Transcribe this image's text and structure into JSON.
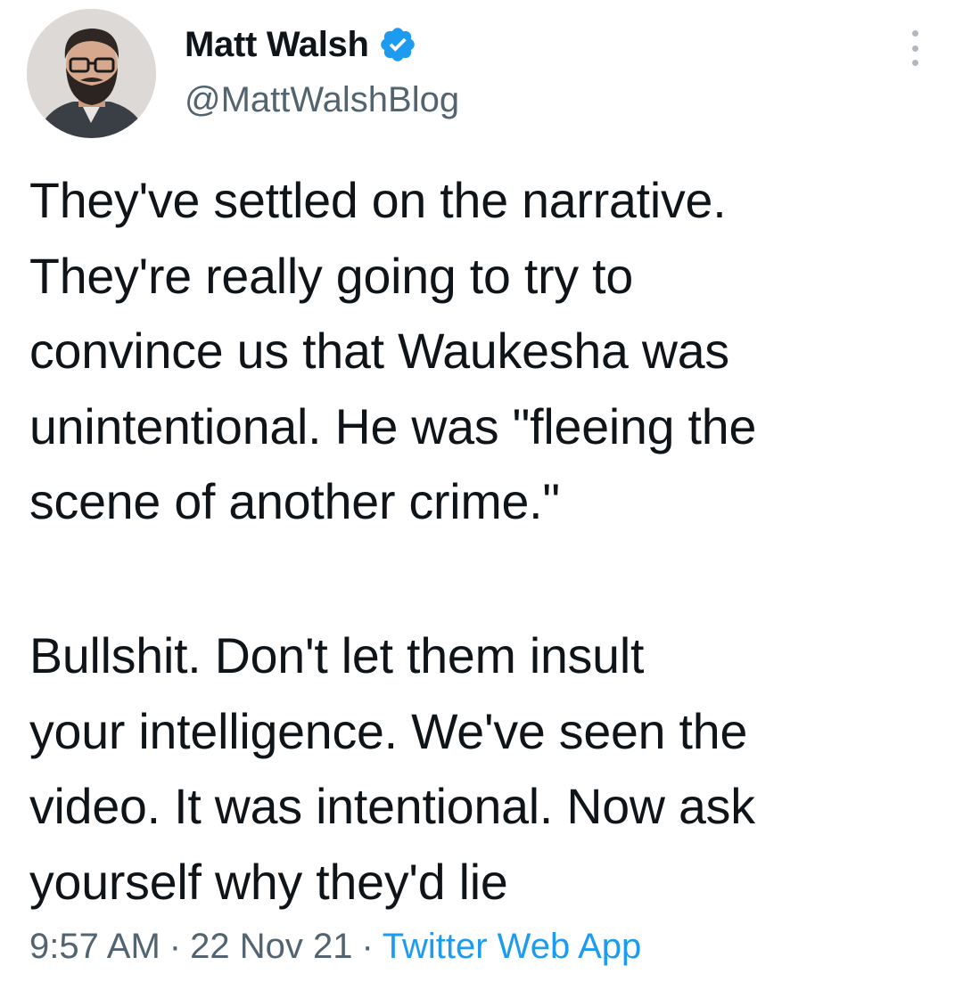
{
  "tweet": {
    "author": {
      "display_name": "Matt Walsh",
      "handle": "@MattWalshBlog",
      "verified": true,
      "verified_icon": "verified-badge-icon",
      "avatar": "profile-photo"
    },
    "more_menu_icon": "more-vertical-icon",
    "text": {
      "paragraph_1": [
        "They've settled on the narrative.",
        "They're really going to try to",
        "convince us that Waukesha was",
        "unintentional. He was \"fleeing the",
        "scene of another crime.\""
      ],
      "paragraph_2": [
        "Bullshit. Don't let them insult",
        "your intelligence. We've seen the",
        "video. It was intentional. Now ask",
        "yourself why they'd lie"
      ]
    },
    "meta": {
      "time": "9:57 AM",
      "separator": "·",
      "date": "22 Nov 21",
      "source": "Twitter Web App"
    }
  },
  "colors": {
    "text_primary": "#0f1419",
    "text_secondary": "#536471",
    "accent_blue": "#1d9bf0",
    "background": "#ffffff"
  }
}
